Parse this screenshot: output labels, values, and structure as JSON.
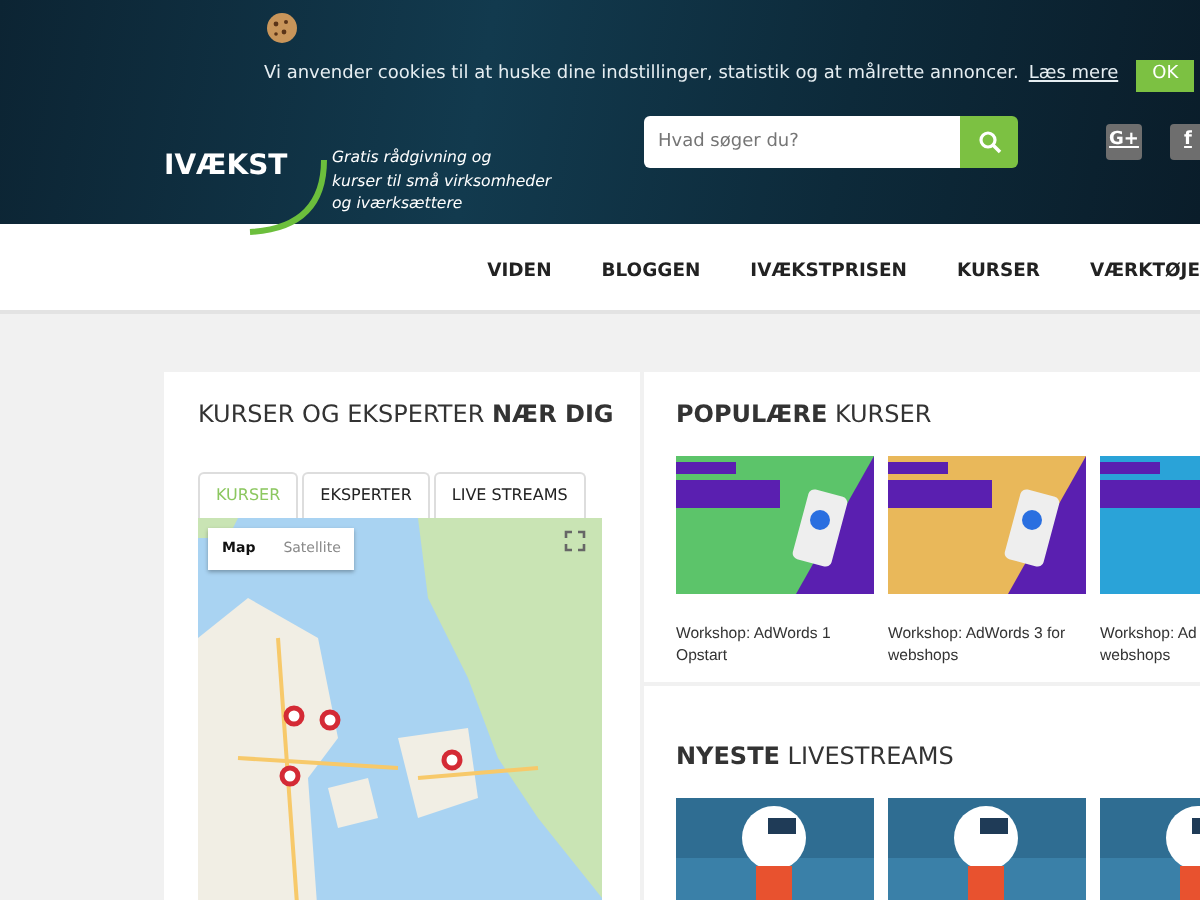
{
  "cookie_bar": {
    "message": "Vi anvender cookies til at huske dine indstillinger, statistik og at målrette annoncer.",
    "link": "Læs mere",
    "button": "OK"
  },
  "header": {
    "logo": "IVÆKST",
    "tagline": [
      "Gratis rådgivning og",
      "kurser til små virksomheder",
      "og iværksættere"
    ],
    "search": {
      "placeholder": "Hvad søger du?"
    },
    "social": [
      "G+",
      "f"
    ]
  },
  "nav": [
    "VIDEN",
    "BLOGGEN",
    "IVÆKSTPRISEN",
    "KURSER",
    "VÆRKTØJE"
  ],
  "map_panel": {
    "title": "KURSER OG EKSPERTER **NÆR DIG**",
    "tabs": [
      {
        "label": "KURSER",
        "selected": true
      },
      {
        "label": "EKSPERTER",
        "selected": false
      },
      {
        "label": "LIVE STREAMS",
        "selected": false
      }
    ],
    "map_types": [
      {
        "label": "Map",
        "selected": true
      },
      {
        "label": "Satellite",
        "selected": false
      }
    ]
  },
  "popular": {
    "title": "**POPULÆRE** KURSER",
    "courses": [
      {
        "lines": [
          "Workshop: AdWords 1",
          "Opstart"
        ]
      },
      {
        "lines": [
          "Workshop: AdWords 3 for",
          "webshops"
        ]
      },
      {
        "lines": [
          "Workshop: Ad",
          "webshops"
        ]
      }
    ]
  },
  "livestreams": {
    "title": "**NYESTE** LIVESTREAMS"
  }
}
